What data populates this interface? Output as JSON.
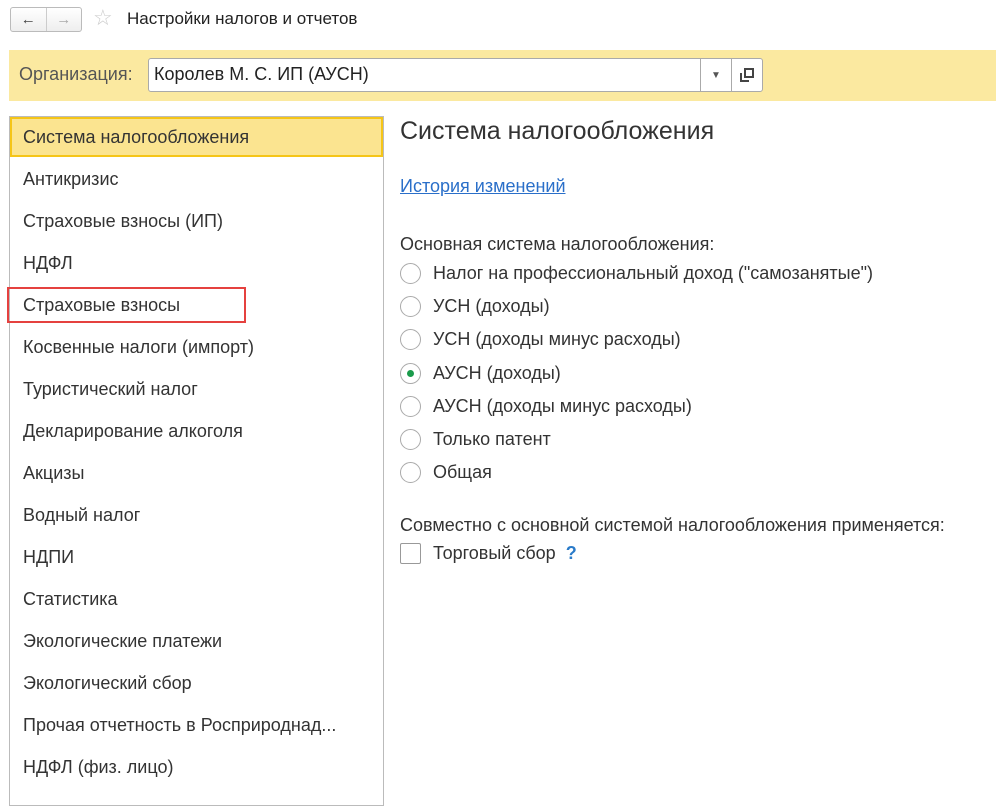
{
  "window": {
    "title": "Настройки налогов и отчетов",
    "back": "←",
    "forward": "→",
    "star": "☆"
  },
  "org": {
    "label": "Организация:",
    "value": "Королев М. С. ИП (АУСН)"
  },
  "sidebar": {
    "items": [
      "Система налогообложения",
      "Антикризис",
      "Страховые взносы (ИП)",
      "НДФЛ",
      "Страховые взносы",
      "Косвенные налоги (импорт)",
      "Туристический налог",
      "Декларирование алкоголя",
      "Акцизы",
      "Водный налог",
      "НДПИ",
      "Статистика",
      "Экологические платежи",
      "Экологический сбор",
      "Прочая отчетность в Росприроднад...",
      "НДФЛ (физ. лицо)"
    ],
    "selected_index": 0,
    "highlighted_index": 4
  },
  "main": {
    "title": "Система налогообложения",
    "history_link": "История изменений",
    "system_label": "Основная система налогообложения:",
    "options": [
      "Налог на профессиональный доход (\"самозанятые\")",
      "УСН (доходы)",
      "УСН (доходы минус расходы)",
      "АУСН (доходы)",
      "АУСН (доходы минус расходы)",
      "Только патент",
      "Общая"
    ],
    "selected_option": 3,
    "combined_label": "Совместно с основной системой налогообложения применяется:",
    "trade_fee": "Торговый сбор",
    "trade_fee_checked": false,
    "help": "?"
  },
  "colors": {
    "accent": "#fbe9a0",
    "selection": "#f5c518",
    "highlight": "#e5413f",
    "radio": "#1a9b4b",
    "link": "#2a6fc9"
  }
}
